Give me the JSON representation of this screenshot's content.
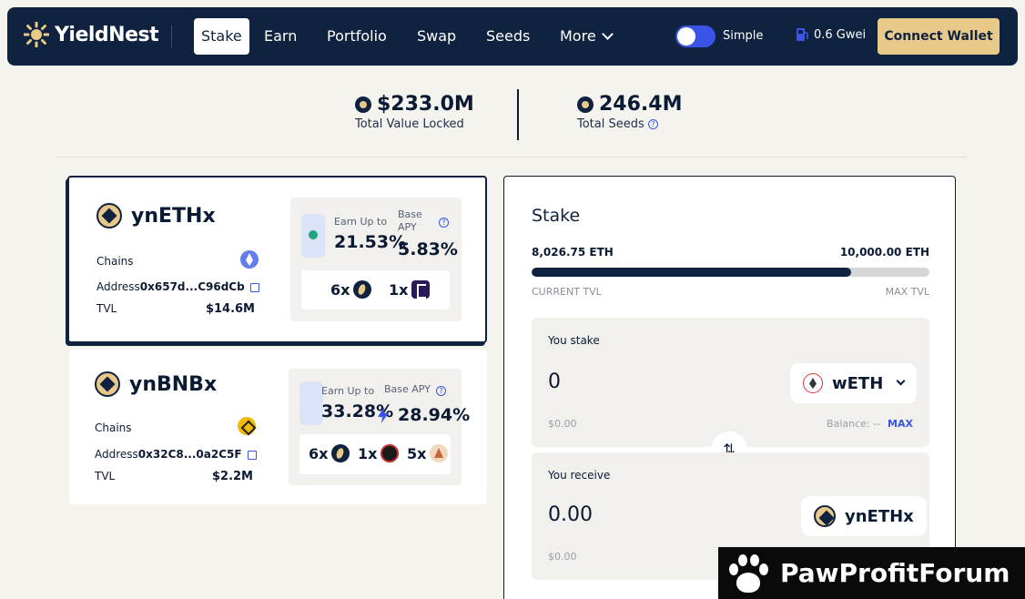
{
  "nav": {
    "brand": "YieldNest",
    "items": [
      {
        "label": "Stake",
        "active": true
      },
      {
        "label": "Earn"
      },
      {
        "label": "Portfolio"
      },
      {
        "label": "Swap"
      },
      {
        "label": "Seeds"
      },
      {
        "label": "More"
      }
    ],
    "mode_label": "Simple",
    "gas": "0.6 Gwei",
    "connect_label": "Connect Wallet"
  },
  "stats": {
    "tvl_value": "$233.0M",
    "tvl_label": "Total Value Locked",
    "seeds_value": "246.4M",
    "seeds_label": "Total Seeds"
  },
  "tokens": [
    {
      "name": "ynETHx",
      "chains_label": "Chains",
      "address_label": "Address",
      "address": "0x657d...C96dCb",
      "tvl_label": "TVL",
      "tvl": "$14.6M",
      "earn_label": "Earn Up to",
      "earn_value": "21.53%",
      "base_label": "Base APY",
      "base_value": "5.83%",
      "multipliers": [
        "6x",
        "1x"
      ]
    },
    {
      "name": "ynBNBx",
      "chains_label": "Chains",
      "address_label": "Address",
      "address": "0x32C8...0a2C5F",
      "tvl_label": "TVL",
      "tvl": "$2.2M",
      "earn_label": "Earn Up to",
      "earn_value": "33.28%",
      "base_label": "Base APY",
      "base_value": "28.94%",
      "multipliers": [
        "6x",
        "1x",
        "5x"
      ]
    }
  ],
  "stake": {
    "title": "Stake",
    "current_tvl": "8,026.75 ETH",
    "max_tvl": "10,000.00 ETH",
    "current_tvl_label": "CURRENT TVL",
    "max_tvl_label": "MAX TVL",
    "progress": 0.8027,
    "you_stake_label": "You stake",
    "stake_amount": "0",
    "stake_usd": "$0.00",
    "stake_token": "wETH",
    "balance_label": "Balance: --",
    "max_label": "MAX",
    "you_receive_label": "You receive",
    "receive_amount": "0.00",
    "receive_usd": "$0.00",
    "receive_token": "ynETHx"
  },
  "watermark": "PawProfitForum",
  "colors": {
    "navy": "#0f2240",
    "accent": "#e8c98a",
    "blue": "#3a54e8"
  }
}
